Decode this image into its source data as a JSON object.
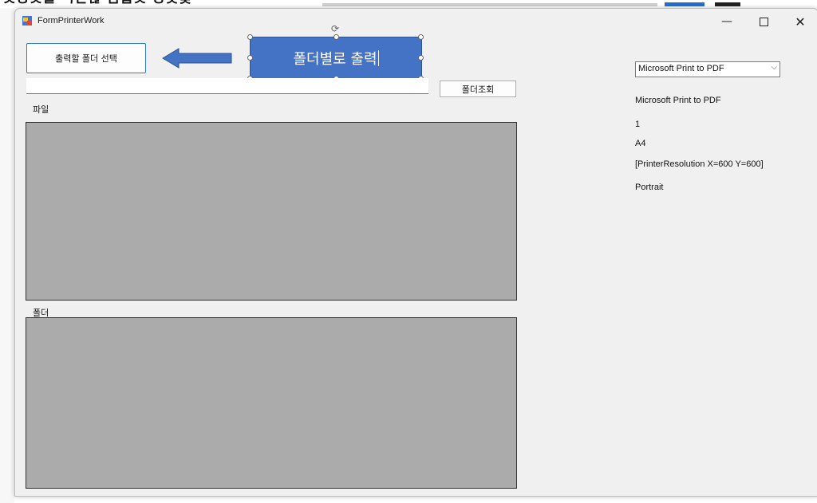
{
  "window": {
    "title": "FormPrinterWork",
    "controls": {
      "minimize": "—",
      "maximize": "",
      "close": "✕"
    }
  },
  "toolbar": {
    "select_folder_label": "출력할 폴더 선택",
    "query_folder_label": "폴더조회"
  },
  "annotation": {
    "callout_text": "폴더별로 출력",
    "arrow_icon": "left-arrow-icon",
    "color": "#4472c4"
  },
  "path_input": {
    "value": "",
    "placeholder": ""
  },
  "files": {
    "label": "파일"
  },
  "folders": {
    "label": "폴더"
  },
  "printer": {
    "selected": "Microsoft Print to PDF",
    "name": "Microsoft Print to PDF",
    "copies": "1",
    "paper": "A4",
    "resolution": "[PrinterResolution X=600 Y=600]",
    "orientation": "Portrait"
  }
}
